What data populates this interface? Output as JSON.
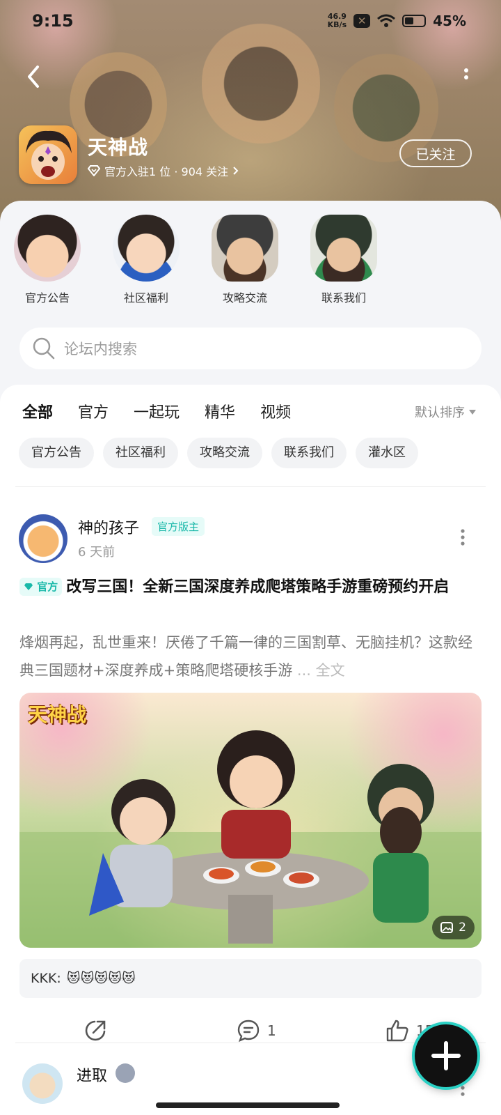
{
  "status": {
    "time": "9:15",
    "net_speed_value": "46.9",
    "net_speed_unit": "KB/s",
    "battery": "45%"
  },
  "header": {
    "game_name": "天神战",
    "meta": "官方入驻1 位 · 904 关注",
    "follow_label": "已关注"
  },
  "categories": [
    {
      "label": "官方公告"
    },
    {
      "label": "社区福利"
    },
    {
      "label": "攻略交流"
    },
    {
      "label": "联系我们"
    }
  ],
  "search": {
    "placeholder": "论坛内搜索"
  },
  "tabs": [
    {
      "label": "全部",
      "active": true
    },
    {
      "label": "官方"
    },
    {
      "label": "一起玩"
    },
    {
      "label": "精华"
    },
    {
      "label": "视频"
    }
  ],
  "sort_label": "默认排序",
  "chips": [
    "官方公告",
    "社区福利",
    "攻略交流",
    "联系我们",
    "灌水区"
  ],
  "post": {
    "author": "神的孩子",
    "author_badge": "官方版主",
    "time": "6 天前",
    "title_badge": "官方",
    "title": "改写三国！全新三国深度养成爬塔策略手游重磅预约开启",
    "excerpt": "烽烟再起，乱世重来！厌倦了千篇一律的三国割草、无脑挂机？这款经典三国题材+深度养成+策略爬塔硬核手游",
    "read_more": "... 全文",
    "image_title": "天神战",
    "image_count": "2",
    "comment_user": "KKK:",
    "comment_text": "😻😻😻😻😻",
    "comment_count": "1",
    "like_count": "15"
  },
  "next_post": {
    "author": "进取"
  },
  "colors": {
    "accent": "#17d2c3",
    "badge_bg": "#e6fbf8",
    "badge_text": "#19b9a9"
  }
}
